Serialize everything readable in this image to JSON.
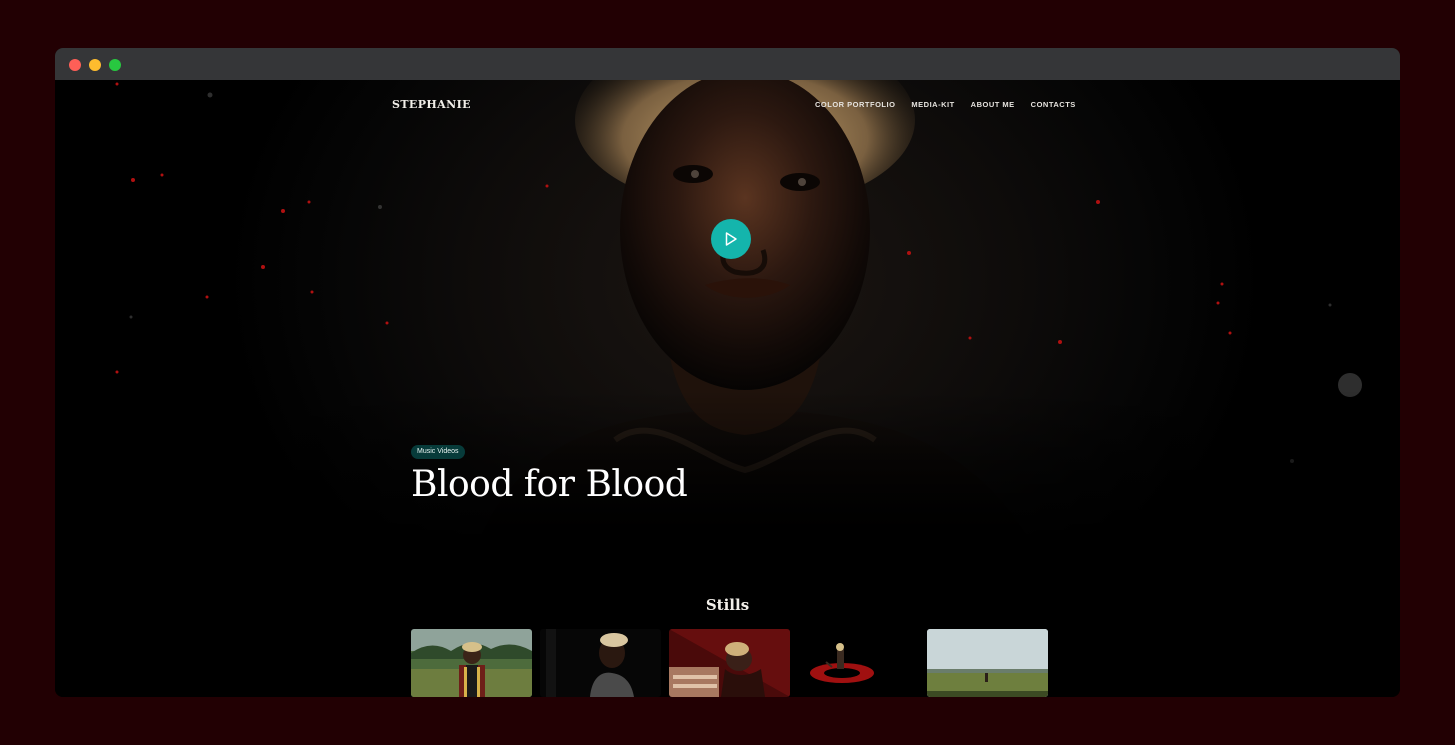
{
  "nav": {
    "brand": "STEPHANIE",
    "links": [
      "COLOR PORTFOLIO",
      "MEDIA-KIT",
      "ABOUT ME",
      "CONTACTS"
    ]
  },
  "hero": {
    "category_tag": "Music Videos",
    "title": "Blood for Blood",
    "play_icon": "play-icon"
  },
  "stills": {
    "heading": "Stills",
    "items": [
      {
        "name": "still-field-portrait"
      },
      {
        "name": "still-dark-profile"
      },
      {
        "name": "still-red-overhead"
      },
      {
        "name": "still-red-circle"
      },
      {
        "name": "still-meadow-sky"
      }
    ]
  },
  "colors": {
    "page_background": "#220003",
    "titlebar": "#353638",
    "accent_teal": "#14b5ac",
    "tag_background": "#073b3a"
  }
}
